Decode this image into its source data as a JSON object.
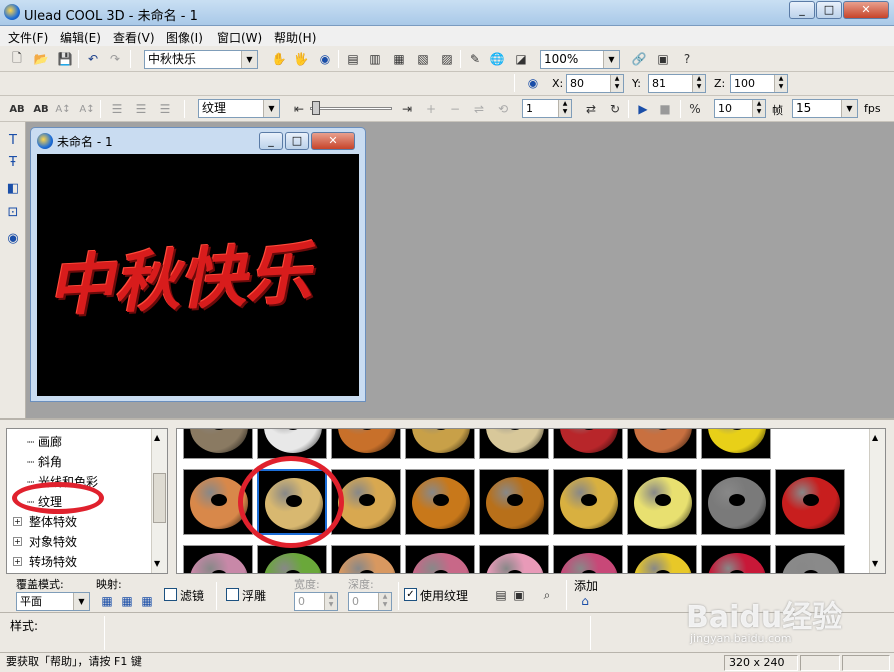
{
  "window": {
    "title": "Ulead COOL 3D - 未命名 - 1",
    "minimize": "_",
    "maximize": "□",
    "close": "✕"
  },
  "menubar": [
    {
      "label": "文件(F)"
    },
    {
      "label": "编辑(E)"
    },
    {
      "label": "查看(V)"
    },
    {
      "label": "图像(I)"
    },
    {
      "label": "窗口(W)"
    },
    {
      "label": "帮助(H)"
    }
  ],
  "toolbar1": {
    "text_combo": "中秋快乐",
    "zoom_combo": "100%"
  },
  "toolbar2": {
    "x_label": "X:",
    "x_value": "80",
    "y_label": "Y:",
    "y_value": "81",
    "z_label": "Z:",
    "z_value": "100"
  },
  "toolbar3": {
    "effect_combo": "纹理",
    "frame_value": "1",
    "frames_value": "10",
    "frame_unit": "帧",
    "fps_value": "15",
    "fps_unit": "fps"
  },
  "child_window": {
    "title": "未命名 - 1",
    "canvas_text": "中秋快乐",
    "canvas_text_color": "#d81c1c"
  },
  "tree": {
    "items": [
      {
        "label": "画廊",
        "expandable": false
      },
      {
        "label": "斜角",
        "expandable": false
      },
      {
        "label": "光线和色彩",
        "expandable": false
      },
      {
        "label": "纹理",
        "expandable": false,
        "selected": true
      },
      {
        "label": "整体特效",
        "expandable": true
      },
      {
        "label": "对象特效",
        "expandable": true
      },
      {
        "label": "转场特效",
        "expandable": true
      }
    ]
  },
  "gallery": {
    "rows": [
      [
        "#8a7a62",
        "#e8e8e8",
        "#c8702a",
        "#c8a048",
        "#d8c89a",
        "#b8262a",
        "#c87040",
        "#e8d018"
      ],
      [
        "#d8884a",
        "#d8b870",
        "#d8a850",
        "#c8781a",
        "#b8701a",
        "#d8b040",
        "#e8e070",
        "#7a7a7a",
        "#c81e1e"
      ],
      [
        "#c888a8",
        "#6aa83a",
        "#d89860",
        "#c86888",
        "#e89ab8",
        "#c84878",
        "#e8c828",
        "#c81838",
        "#8a8a8a"
      ]
    ],
    "selected_index": "1,1"
  },
  "properties": {
    "overlay_label": "覆盖模式:",
    "overlay_value": "平面",
    "mapping_label": "映射:",
    "filter_label": "滤镜",
    "filter_checked": false,
    "emboss_label": "浮雕",
    "emboss_checked": false,
    "width_label": "宽度:",
    "width_value": "0",
    "depth_label": "深度:",
    "depth_value": "0",
    "use_texture_label": "使用纹理",
    "use_texture_checked": true,
    "add_label": "添加",
    "style_label": "样式:"
  },
  "statusbar": {
    "help_text": "要获取「帮助」，请按 F1 键",
    "size": "320 x 240"
  },
  "watermark": {
    "logo": "Baidu经验",
    "url": "jingyan.baidu.com"
  },
  "colors": {
    "highlight": "#e0212d",
    "titlebar": "#b9d3ee"
  }
}
